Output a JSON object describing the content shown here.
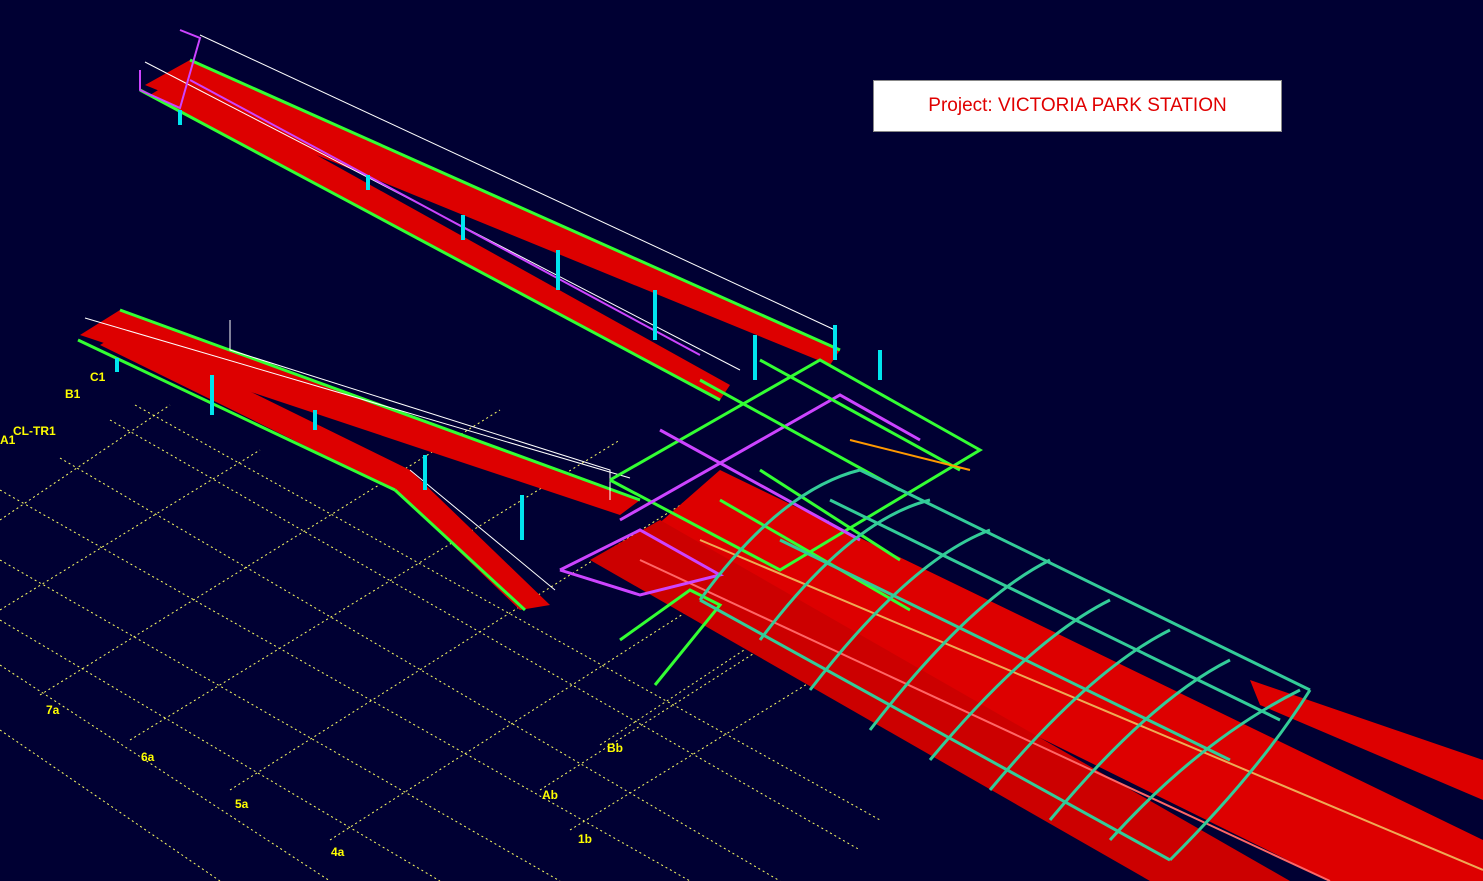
{
  "project": {
    "title": "Project: VICTORIA PARK STATION"
  },
  "grid_labels": {
    "c1": "C1",
    "b1": "B1",
    "cl_tr1": "CL-TR1",
    "a1": "A1",
    "7a": "7a",
    "6a": "6a",
    "5a": "5a",
    "4a": "4a",
    "bb": "Bb",
    "ab": "Ab",
    "1b": "1b"
  },
  "colors": {
    "background": "#000033",
    "grid": "#ffff66",
    "platform": "#dd0000",
    "platform_edge": "#ff3333",
    "rafter": "#33cc99",
    "beam_green": "#33ff33",
    "brace_magenta": "#cc44ff",
    "column_cyan": "#00e5ee",
    "handrail": "#ffffff",
    "label": "#ffff00",
    "title_text": "#e00000"
  }
}
